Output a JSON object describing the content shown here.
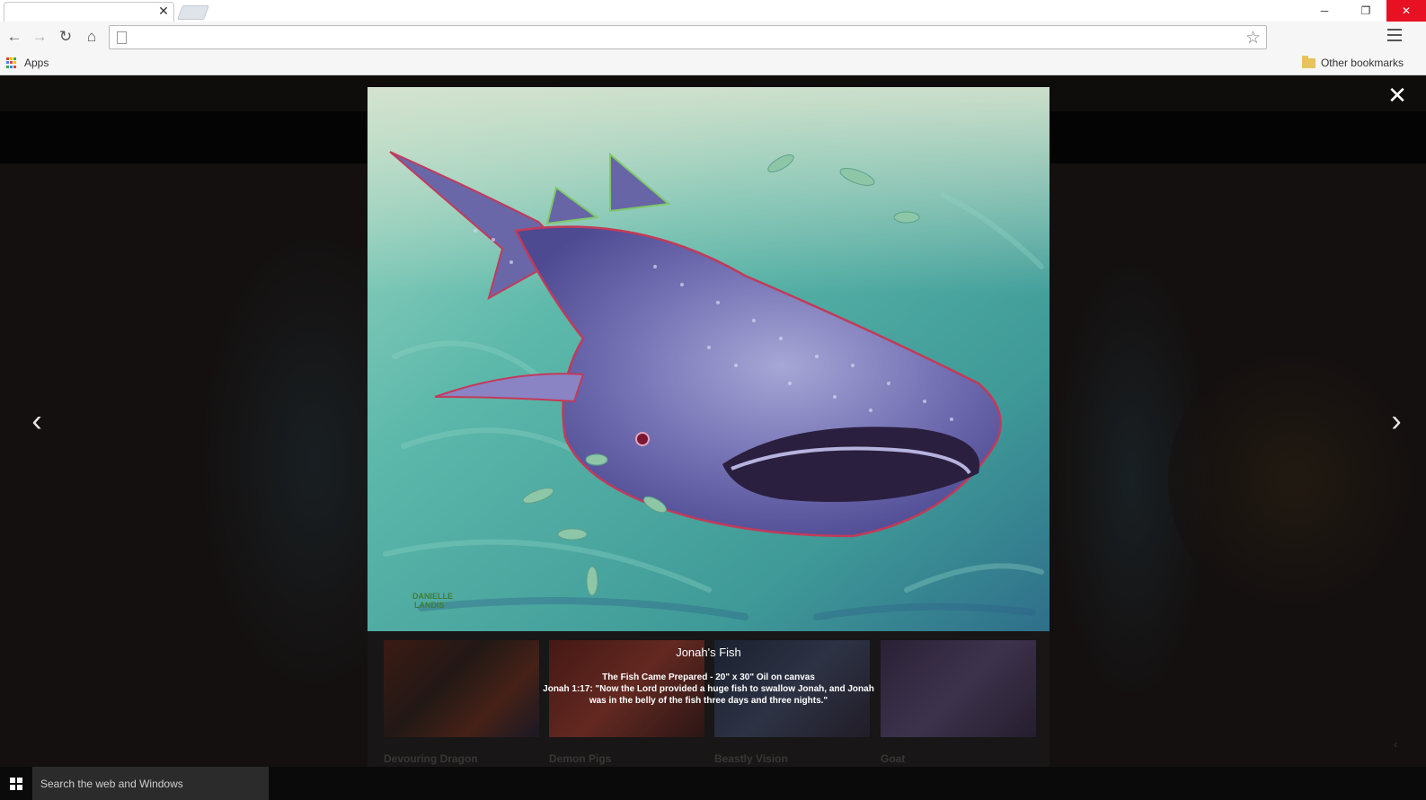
{
  "browser": {
    "tab_close": "✕",
    "window_controls": {
      "minimize": "─",
      "maximize": "❐",
      "close": "✕"
    },
    "nav": {
      "back": "←",
      "forward": "→",
      "reload": "↻",
      "home": "⌂"
    },
    "star_icon": "☆",
    "bookmarks": {
      "apps_label": "Apps",
      "other_label": "Other bookmarks"
    }
  },
  "lightbox": {
    "close_icon": "✕",
    "prev_icon": "‹",
    "next_icon": "›",
    "title": "Jonah's Fish",
    "caption_line1": "The Fish Came Prepared - 20\" x 30\" Oil on canvas",
    "caption_line2": "Jonah 1:17: \"Now the Lord provided a huge fish to swallow Jonah, and Jonah",
    "caption_line3": "was in the belly of the fish three days and three nights.\"",
    "signature": "DANIELLE LANDIS"
  },
  "gallery": {
    "items": [
      {
        "label": "Devouring Dragon"
      },
      {
        "label": "Demon Pigs"
      },
      {
        "label": "Beastly Vision"
      },
      {
        "label": "Goat"
      }
    ],
    "scroll_icon": "‹"
  },
  "taskbar": {
    "search_placeholder": "Search the web and Windows"
  },
  "colors": {
    "close_red": "#e81123",
    "overlay": "#141010",
    "sea": "#4b9e9a",
    "shark": "#6c6aa8"
  }
}
